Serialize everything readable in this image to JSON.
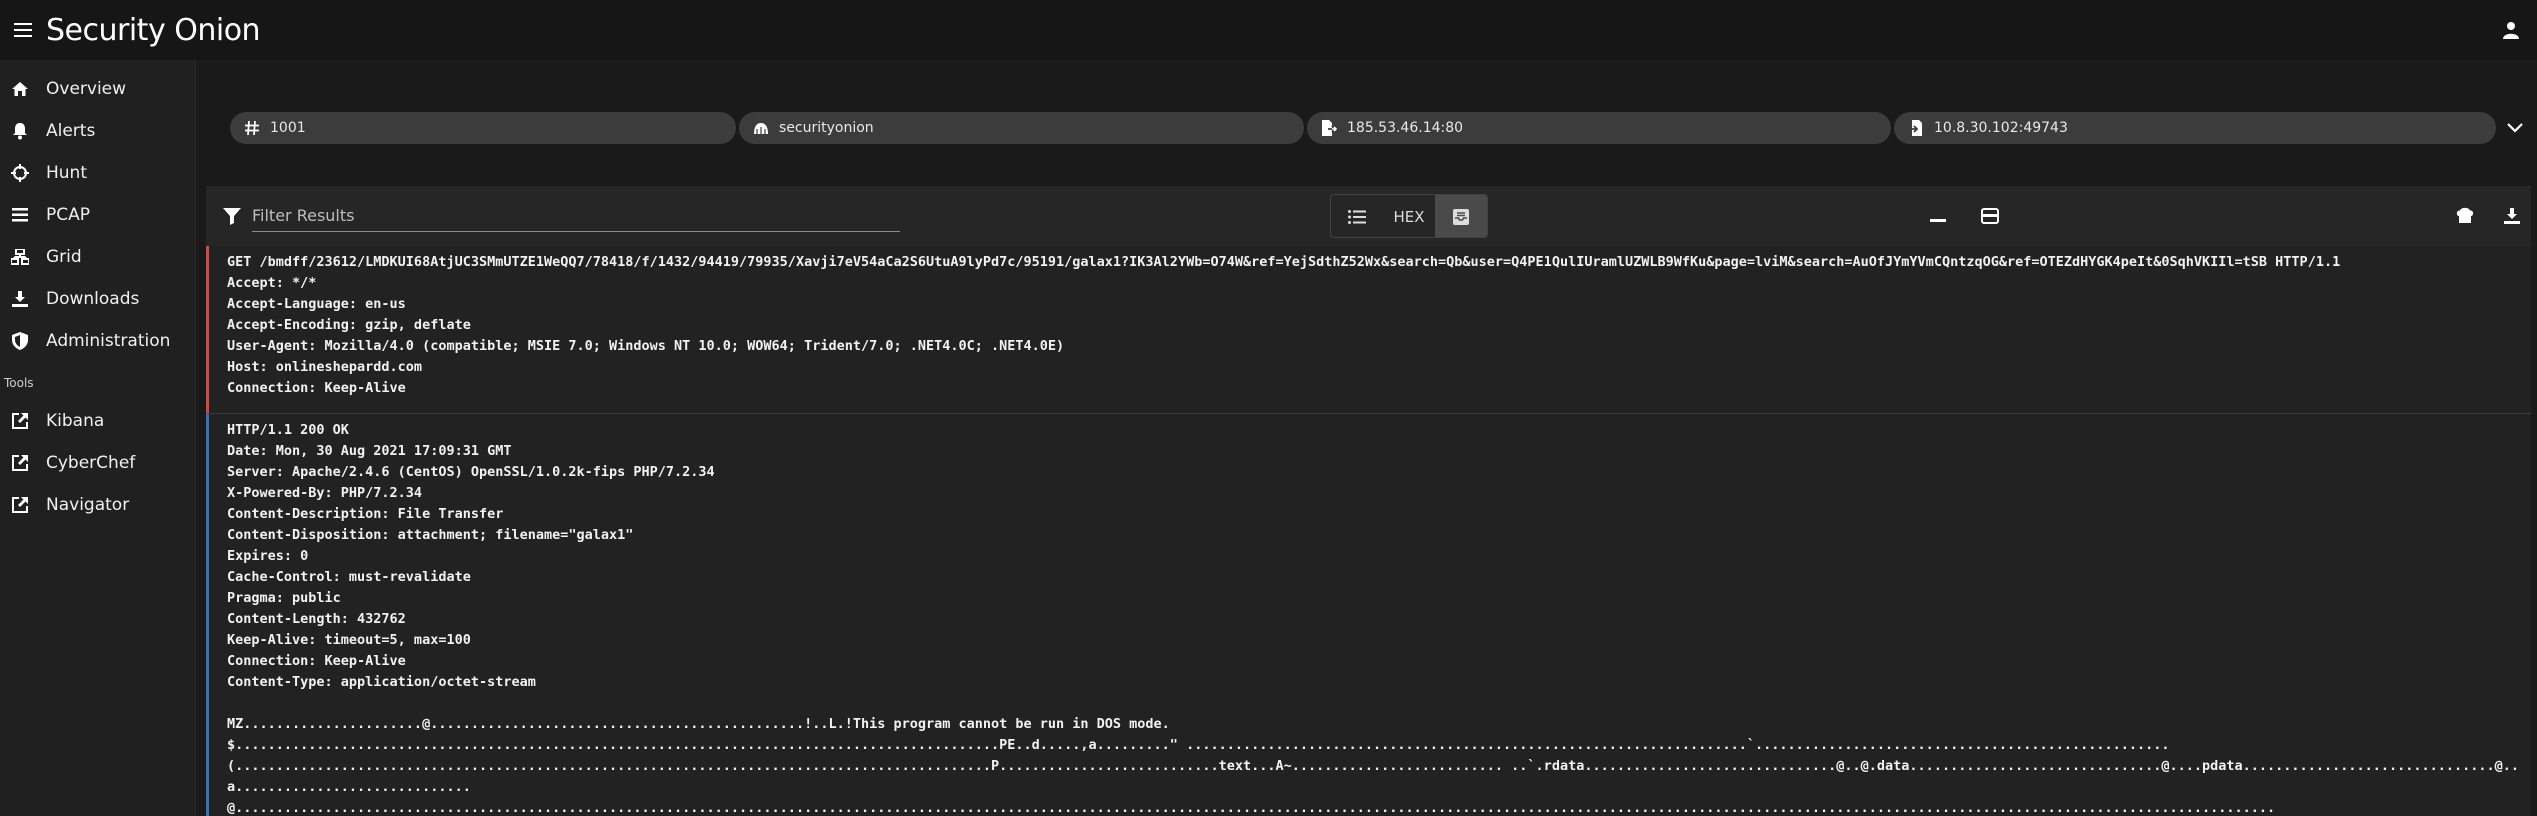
{
  "app": {
    "name": "Security Onion"
  },
  "sidebar": {
    "items": [
      {
        "label": "Overview",
        "icon": "home-icon"
      },
      {
        "label": "Alerts",
        "icon": "bell-icon"
      },
      {
        "label": "Hunt",
        "icon": "crosshair-icon"
      },
      {
        "label": "PCAP",
        "icon": "list-icon"
      },
      {
        "label": "Grid",
        "icon": "grid-icon"
      },
      {
        "label": "Downloads",
        "icon": "download-icon"
      },
      {
        "label": "Administration",
        "icon": "shield-icon"
      }
    ],
    "tools_heading": "Tools",
    "tools": [
      {
        "label": "Kibana",
        "icon": "external-link-icon"
      },
      {
        "label": "CyberChef",
        "icon": "external-link-icon"
      },
      {
        "label": "Navigator",
        "icon": "external-link-icon"
      }
    ]
  },
  "chips": [
    {
      "label": "1001",
      "icon": "hash-icon"
    },
    {
      "label": "securityonion",
      "icon": "sensor-icon"
    },
    {
      "label": "185.53.46.14:80",
      "icon": "source-icon"
    },
    {
      "label": "10.8.30.102:49743",
      "icon": "destination-icon"
    }
  ],
  "toolbar": {
    "filter_placeholder": "Filter Results",
    "hex_label": "HEX"
  },
  "request_lines": [
    "GET /bmdff/23612/LMDKUI68AtjUC3SMmUTZE1WeQQ7/78418/f/1432/94419/79935/Xavji7eV54aCa2S6UtuA9lyPd7c/95191/galax1?IK3Al2YWb=O74W&ref=YejSdthZ52Wx&search=Qb&user=Q4PE1QulIUramlUZWLB9WfKu&page=lviM&search=AuOfJYmYVmCQntzqOG&ref=OTEZdHYGK4peIt&0SqhVKIIl=tSB HTTP/1.1",
    "Accept: */*",
    "Accept-Language: en-us",
    "Accept-Encoding: gzip, deflate",
    "User-Agent: Mozilla/4.0 (compatible; MSIE 7.0; Windows NT 10.0; WOW64; Trident/7.0; .NET4.0C; .NET4.0E)",
    "Host: onlineshepardd.com",
    "Connection: Keep-Alive"
  ],
  "response_lines": [
    "HTTP/1.1 200 OK",
    "Date: Mon, 30 Aug 2021 17:09:31 GMT",
    "Server: Apache/2.4.6 (CentOS) OpenSSL/1.0.2k-fips PHP/7.2.34",
    "X-Powered-By: PHP/7.2.34",
    "Content-Description: File Transfer",
    "Content-Disposition: attachment; filename=\"galax1\"",
    "Expires: 0",
    "Cache-Control: must-revalidate",
    "Pragma: public",
    "Content-Length: 432762",
    "Keep-Alive: timeout=5, max=100",
    "Connection: Keep-Alive",
    "Content-Type: application/octet-stream"
  ],
  "body_lines": [
    "MZ......................@..............................................!..L.!This program cannot be run in DOS mode.",
    "$..............................................................................................PE..d.....,a.........\" .....................................................................`...................................................",
    "(.............................................................................................P...........................text...A~.......................... ..`.rdata...............................@..@.data...............................@....pdata...............................@..",
    "a.............................",
    "@..........................................................................................................................................................................................................................................................."
  ]
}
